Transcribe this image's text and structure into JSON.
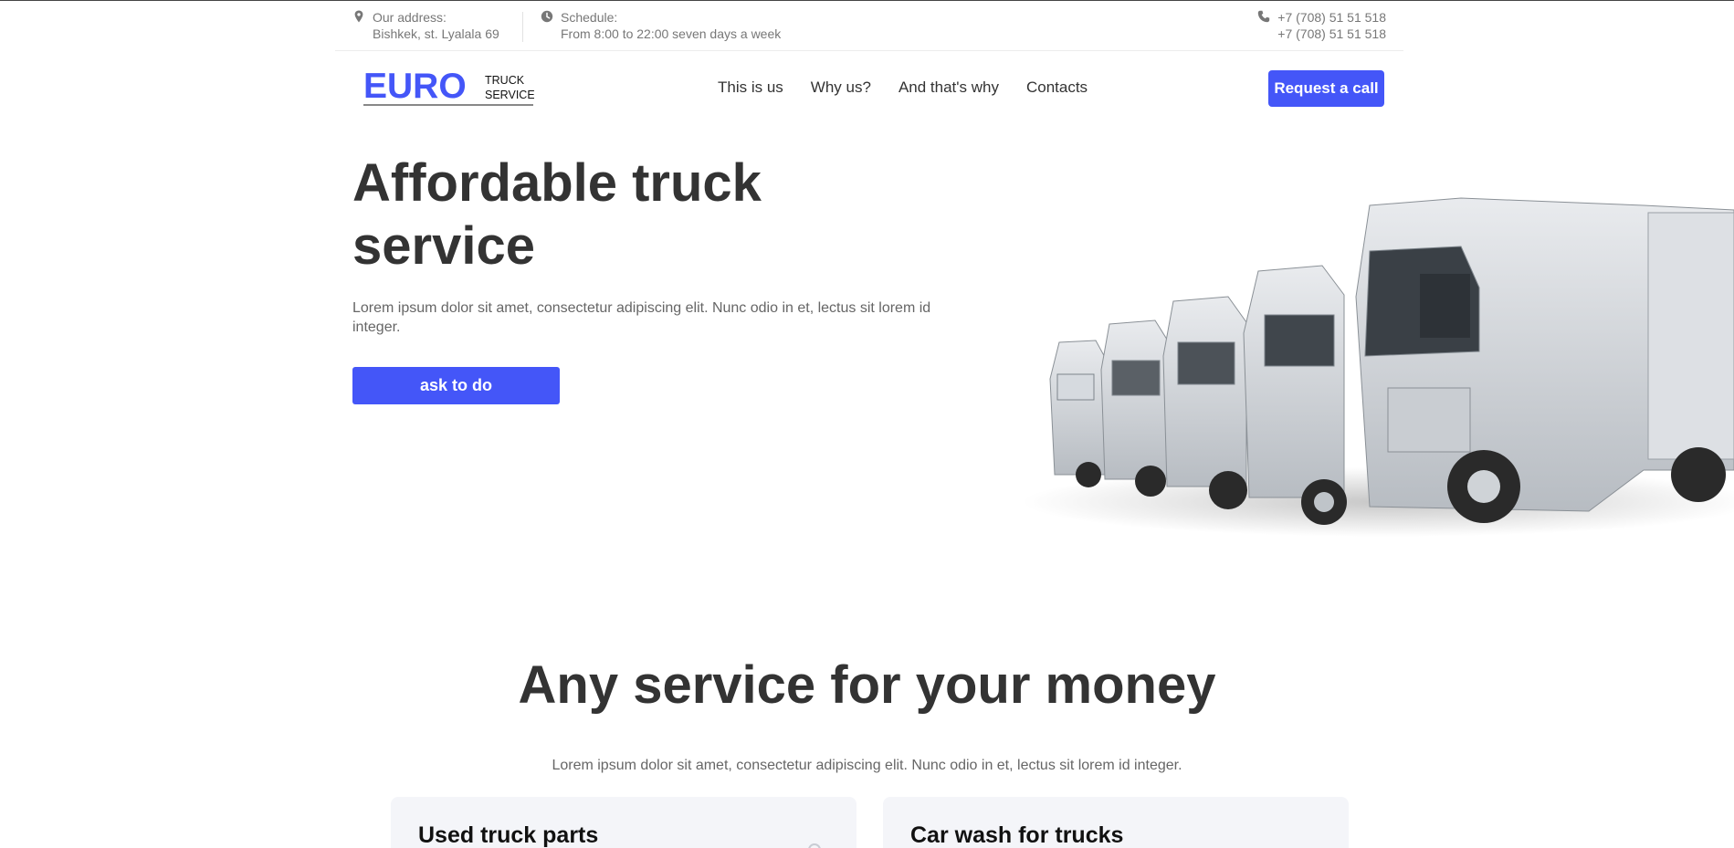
{
  "topbar": {
    "address_label": "Our address:",
    "address_value": "Bishkek, st. Lyalala 69",
    "schedule_label": "Schedule:",
    "schedule_value": "From 8:00 to 22:00 seven days a week",
    "phone_1": "+7 (708) 51 51 518",
    "phone_2": "+7 (708) 51 51 518",
    "icons": [
      "location-pin-icon",
      "clock-icon",
      "phone-icon"
    ]
  },
  "header": {
    "logo_main": "EURO",
    "logo_line1": "TRUCK",
    "logo_line2": "SERVICE",
    "nav": [
      "This is us",
      "Why us?",
      "And that's why",
      "Contacts"
    ],
    "cta_label": "Request a call"
  },
  "hero": {
    "title": "Affordable truck service",
    "text": "Lorem ipsum dolor sit amet, consectetur adipiscing elit. Nunc odio in et, lectus sit lorem id integer.",
    "button_label": "ask to do"
  },
  "services": {
    "title": "Any service for your money",
    "text": "Lorem ipsum dolor sit amet, consectetur adipiscing elit. Nunc odio in et, lectus sit lorem id integer.",
    "cards": [
      {
        "title": "Used truck parts"
      },
      {
        "title": "Car wash for trucks"
      }
    ]
  },
  "colors": {
    "accent": "#4456f8",
    "text_dark": "#333333",
    "text_muted": "#666666",
    "card_bg": "#f4f5f9"
  }
}
